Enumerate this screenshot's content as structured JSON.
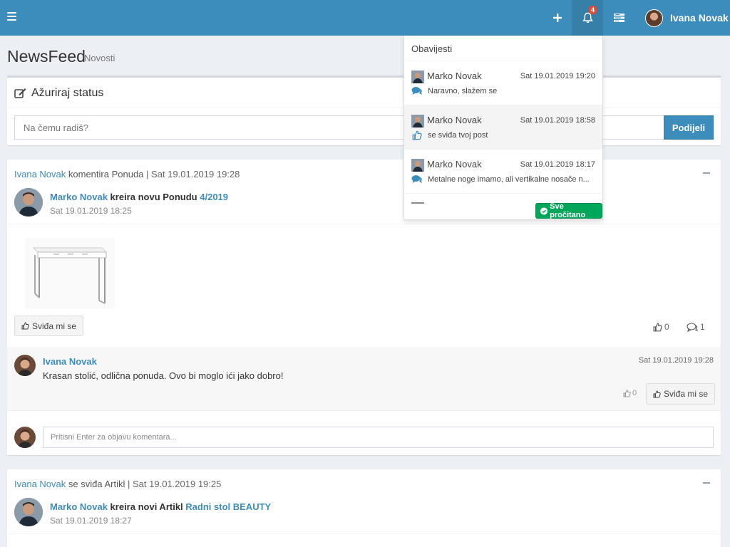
{
  "topbar": {
    "notification_count": "4",
    "user_name": "Ivana Novak",
    "icons": [
      "menu-icon",
      "plus-icon",
      "bell-icon",
      "tasks-icon"
    ]
  },
  "page": {
    "title": "NewsFeed",
    "subtitle": "Novosti"
  },
  "status": {
    "title": "Ažuriraj status",
    "placeholder": "Na čemu radiš?",
    "share_label": "Podijeli"
  },
  "post1": {
    "actor": "Ivana Novak",
    "action": "komentira Ponuda",
    "separator": "|",
    "date": "Sat 19.01.2019 19:28",
    "author": "Marko Novak",
    "author_action": "kreira novu Ponudu",
    "object": "4/2019",
    "author_date": "Sat 19.01.2019 18:25",
    "like_label": "Sviđa mi se",
    "likes": "0",
    "comments": "1",
    "comment": {
      "name": "Ivana Novak",
      "date": "Sat 19.01.2019 19:28",
      "text": "Krasan stolić, odlična ponuda. Ovo bi moglo ići jako dobro!",
      "likes": "0",
      "like_label": "Sviđa mi se"
    },
    "comment_placeholder": "Pritisni Enter za objavu komentara..."
  },
  "post2": {
    "actor": "Ivana Novak",
    "action": "se sviđa Artikl",
    "separator": "|",
    "date": "Sat 19.01.2019 19:25",
    "author": "Marko Novak",
    "author_action": "kreira novi Artikl",
    "object": "Radni stol BEAUTY",
    "author_date": "Sat 19.01.2019 18:27"
  },
  "notifications": {
    "header": "Obavijesti",
    "items": [
      {
        "name": "Marko Novak",
        "date": "Sat 19.01.2019 19:20",
        "text": "Naravno, slažem se",
        "icon": "comment-icon"
      },
      {
        "name": "Marko Novak",
        "date": "Sat 19.01.2019 18:58",
        "text": "se sviđa tvoj post",
        "icon": "thumbs-up-icon"
      },
      {
        "name": "Marko Novak",
        "date": "Sat 19.01.2019 18:17",
        "text": "Metalne noge imamo, ali vertikalne nosače n...",
        "icon": "comment-icon"
      }
    ],
    "mark_all_read": "Sve pročitano"
  },
  "colors": {
    "brand": "#3c8dbc",
    "success": "#00a65a",
    "danger": "#dd4b39"
  }
}
